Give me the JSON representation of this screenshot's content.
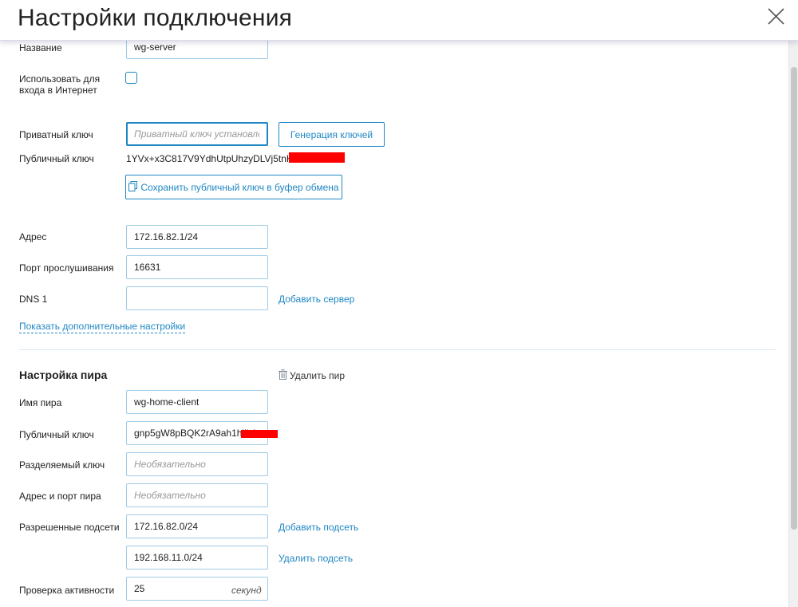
{
  "header": {
    "title": "Настройки подключения"
  },
  "connection": {
    "name_label": "Название",
    "name_value": "wg-server",
    "internet_label_line1": "Использовать для",
    "internet_label_line2": "входа в Интернет",
    "internet_checked": false,
    "private_key_label": "Приватный ключ",
    "private_key_placeholder": "Приватный ключ установлен",
    "generate_keys_button": "Генерация ключей",
    "public_key_label": "Публичный ключ",
    "public_key_value": "1YVx+x3C817V9YdhUtpUhzyDLVj5tnK2m/",
    "copy_key_button": "Сохранить публичный ключ в буфер обмена",
    "address_label": "Адрес",
    "address_value": "172.16.82.1/24",
    "port_label": "Порт прослушивания",
    "port_value": "16631",
    "dns_label": "DNS 1",
    "dns_value": "",
    "add_server_link": "Добавить сервер",
    "more_settings_link": "Показать дополнительные настройки"
  },
  "peer": {
    "section_title": "Настройка пира",
    "delete_peer": "Удалить пир",
    "name_label": "Имя пира",
    "name_value": "wg-home-client",
    "public_key_label": "Публичный ключ",
    "public_key_value": "gnp5gW8pBQK2rA9ah1hiib1",
    "shared_key_label": "Разделяемый ключ",
    "shared_key_placeholder": "Необязательно",
    "endpoint_label": "Адрес и порт пира",
    "endpoint_placeholder": "Необязательно",
    "allowed_subnets_label": "Разрешенные подсети",
    "subnet1_value": "172.16.82.0/24",
    "add_subnet_link": "Добавить подсеть",
    "subnet2_value": "192.168.11.0/24",
    "remove_subnet_link": "Удалить подсеть",
    "keepalive_label": "Проверка активности",
    "keepalive_value": "25",
    "keepalive_unit": "секунд"
  },
  "colors": {
    "accent": "#1f87c3",
    "redaction": "#ff0000"
  },
  "icons": [
    "close-icon",
    "clipboard-icon",
    "trash-icon"
  ]
}
